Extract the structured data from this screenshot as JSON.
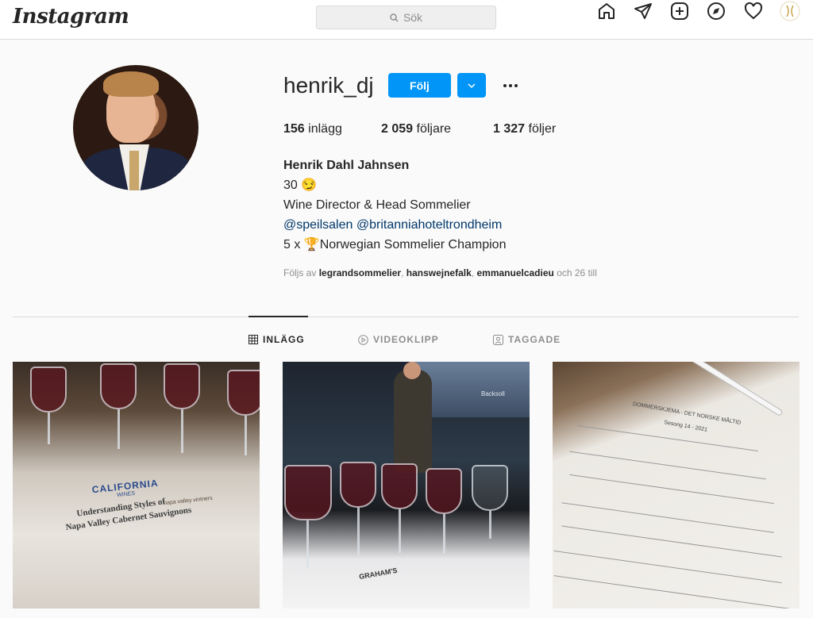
{
  "nav": {
    "logo": "Instagram",
    "search_placeholder": "Sök",
    "icons": [
      "home-icon",
      "direct-icon",
      "new-post-icon",
      "explore-icon",
      "activity-icon",
      "profile-avatar-icon"
    ]
  },
  "profile": {
    "username": "henrik_dj",
    "follow_label": "Följ",
    "stats": {
      "posts_count": "156",
      "posts_label": "inlägg",
      "followers_count": "2 059",
      "followers_label": "följare",
      "following_count": "1 327",
      "following_label": "följer"
    },
    "bio": {
      "name": "Henrik Dahl Jahnsen",
      "line1": "30 😏",
      "line2": "Wine Director & Head Sommelier",
      "line3": "@speilsalen @britanniahoteltrondheim",
      "line4": "5 x 🏆Norwegian Sommelier Champion"
    },
    "followed_by": {
      "prefix": "Följs av",
      "user1": "legrandsommelier",
      "sep1": ",",
      "user2": "hanswejnefalk",
      "sep2": ",",
      "user3": "emmanuelcadieu",
      "suffix": "och 26 till"
    }
  },
  "tabs": [
    {
      "label": "INLÄGG",
      "active": true
    },
    {
      "label": "VIDEOKLIPP",
      "active": false
    },
    {
      "label": "TAGGADE",
      "active": false
    }
  ],
  "posts": {
    "post1": {
      "brand": "CALIFORNIA",
      "brand_sub": "WINES",
      "brand2": "napa valley vintners",
      "card_line1": "Understanding Styles of",
      "card_line2": "Napa Valley Cabernet Sauvignons"
    },
    "post2": {
      "screen_text": "Backsoll",
      "mat_text": "GRAHAM'S"
    },
    "post3": {
      "sheet_title": "DOMMERSKJEMA - DET NORSKE MÅLTID",
      "sheet_sub": "Sesong 14 - 2021"
    }
  },
  "colors": {
    "accent": "#0095f6",
    "link": "#00376b"
  }
}
